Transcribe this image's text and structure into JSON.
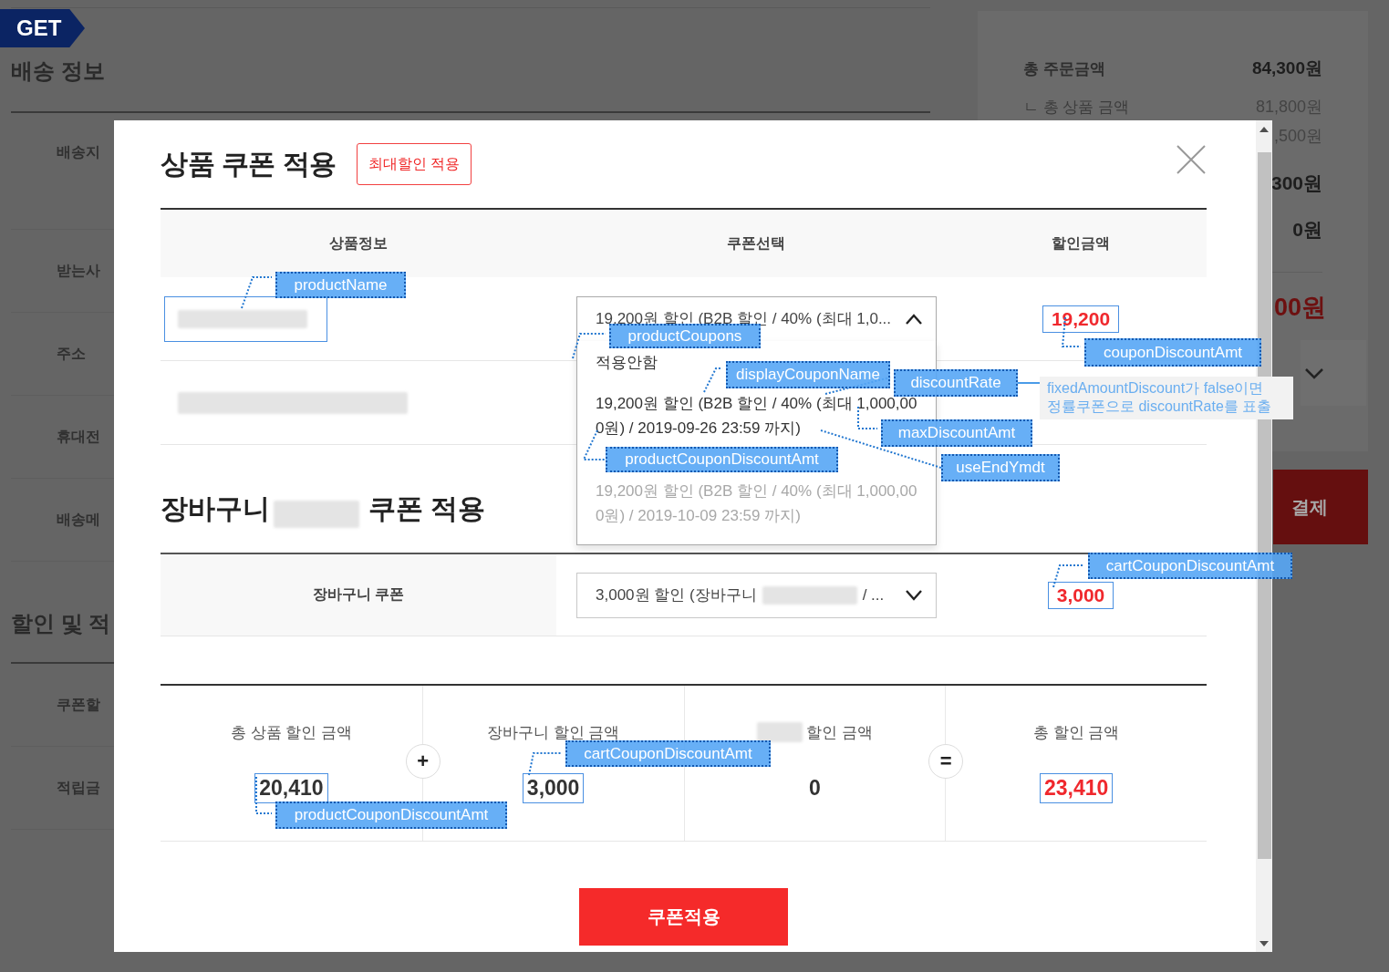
{
  "background_page": {
    "badge": "GET",
    "shipping_title": "배송 정보",
    "shipping_labels": [
      "배송지",
      "받는사",
      "주소",
      "휴대전",
      "배송메"
    ],
    "discount_title": "할인 및 적",
    "discount_labels": [
      "쿠폰할",
      "적립금"
    ],
    "summary": [
      {
        "kind": "total",
        "label": "총 주문금액",
        "value": "84,300원"
      },
      {
        "kind": "sub",
        "label": "ㄴ 총 상품 금액",
        "value": "81,800원"
      },
      {
        "kind": "sub",
        "value": ",500원"
      },
      {
        "kind": "bold",
        "value": "300원"
      },
      {
        "kind": "bold",
        "value": "0원"
      }
    ],
    "final_amount": "00원",
    "pay_button": "결제"
  },
  "modal": {
    "title": "상품 쿠폰 적용",
    "max_discount_button": "최대할인 적용",
    "columns": [
      "상품정보",
      "쿠폰선택",
      "할인금액"
    ],
    "product_rows": [
      {
        "kind": "with_coupon",
        "coupon_select": {
          "value": "19,200원 할인 (B2B 할인 / 40% (최대 1,0...",
          "expanded": true,
          "options": [
            {
              "label": "적용안함",
              "disabled": false
            },
            {
              "label": "19,200원 할인 (B2B 할인 / 40% (최대 1,000,000원) / 2019-09-26 23:59 까지)",
              "disabled": false
            },
            {
              "label": "19,200원 할인 (B2B 할인 / 40% (최대 1,000,000원) / 2019-10-09 23:59 까지)",
              "disabled": true
            }
          ]
        },
        "discount": "19,200"
      },
      {
        "kind": "no_coupon"
      }
    ],
    "cart": {
      "title_before": "장바구니",
      "title_after": "쿠폰 적용",
      "label": "장바구니 쿠폰",
      "coupon_select": {
        "value_before": "3,000원 할인 (장바구니",
        "value_after": "/ ...",
        "expanded": false
      },
      "discount": "3,000"
    },
    "summary": [
      {
        "kind": "plain",
        "label": "총 상품 할인 금액",
        "value": "20,410",
        "operator": "+"
      },
      {
        "kind": "plain",
        "label": "장바구니 할인 금액",
        "value": "3,000"
      },
      {
        "kind": "redacted_prefix",
        "label": "할인 금액",
        "value": "0",
        "operator": "="
      },
      {
        "kind": "total",
        "label": "총 할인 금액",
        "value": "23,410"
      }
    ],
    "apply_button": "쿠폰적용"
  },
  "annotations": [
    {
      "kind": "tag",
      "text": "productName"
    },
    {
      "kind": "tag",
      "text": "productCoupons"
    },
    {
      "kind": "tag",
      "text": "displayCouponName"
    },
    {
      "kind": "tag",
      "text": "discountRate"
    },
    {
      "kind": "tag",
      "text": "couponDiscountAmt"
    },
    {
      "kind": "tag",
      "text": "maxDiscountAmt"
    },
    {
      "kind": "tag",
      "text": "productCouponDiscountAmt"
    },
    {
      "kind": "tag",
      "text": "useEndYmdt"
    },
    {
      "kind": "tag",
      "text": "cartCouponDiscountAmt"
    },
    {
      "kind": "tag",
      "text": "cartCouponDiscountAmt"
    },
    {
      "kind": "tag",
      "text": "productCouponDiscountAmt"
    },
    {
      "kind": "note",
      "text": "fixedAmountDiscount가 false이면\n정률쿠폰으로 discountRate를 표출"
    }
  ]
}
